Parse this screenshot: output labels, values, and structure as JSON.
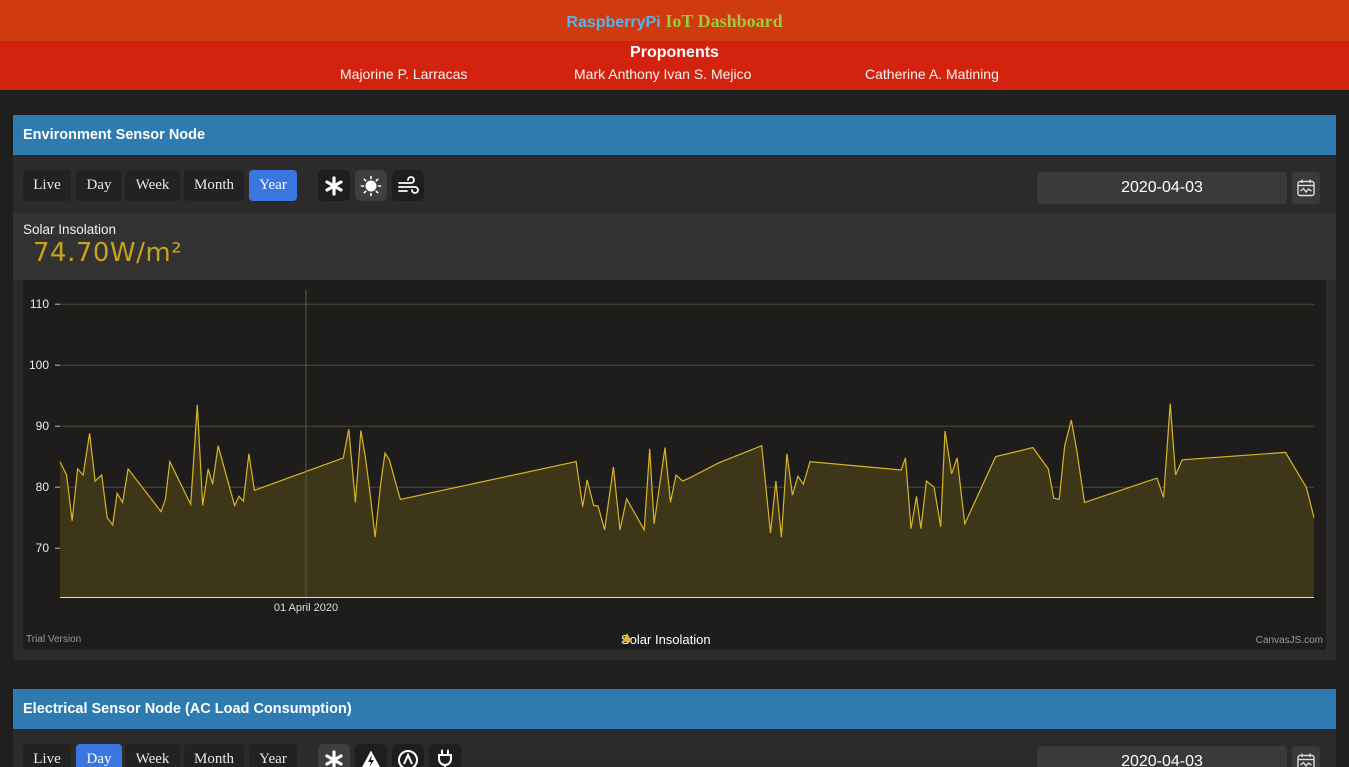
{
  "header": {
    "title_part1": "RaspberryPi",
    "title_part2": "IoT Dashboard"
  },
  "proponents": {
    "title": "Proponents",
    "names": [
      "Majorine P. Larracas",
      "Mark Anthony Ivan S. Mejico",
      "Catherine A. Matining"
    ]
  },
  "environment_panel": {
    "title": "Environment Sensor Node",
    "ranges": [
      "Live",
      "Day",
      "Week",
      "Month",
      "Year"
    ],
    "active_range": "Year",
    "sensor_icons": [
      "asterisk-icon",
      "sun-icon",
      "wind-icon"
    ],
    "active_sensor": "sun-icon",
    "date": "2020-04-03",
    "reading_label": "Solar Insolation",
    "reading_value": "74.70W/m²",
    "trial_text": "Trial Version",
    "credit_text": "CanvasJS.com",
    "colors": {
      "line": "#d8b526",
      "fill": "#403818",
      "value": "#c8a21c"
    }
  },
  "electrical_panel": {
    "title": "Electrical Sensor Node (AC Load Consumption)",
    "ranges": [
      "Live",
      "Day",
      "Week",
      "Month",
      "Year"
    ],
    "active_range": "Day",
    "sensor_icons": [
      "asterisk-icon",
      "lightning-icon",
      "gauge-icon",
      "plug-icon"
    ],
    "date": "2020-04-03"
  },
  "chart_data": {
    "type": "area",
    "title": "",
    "xlabel": "",
    "ylabel": "",
    "y_ticks": [
      70,
      80,
      90,
      100,
      110
    ],
    "ylim": [
      62,
      112
    ],
    "x_tick_labels": [
      "01 April 2020"
    ],
    "grid": true,
    "legend": "bottom-center",
    "series": [
      {
        "name": "Solar Insolation",
        "points": [
          [
            0.0,
            84.2
          ],
          [
            0.3,
            82.0
          ],
          [
            0.55,
            74.5
          ],
          [
            0.8,
            83.0
          ],
          [
            1.05,
            82.0
          ],
          [
            1.35,
            88.8
          ],
          [
            1.6,
            81.0
          ],
          [
            1.9,
            82.0
          ],
          [
            2.15,
            75.0
          ],
          [
            2.4,
            73.8
          ],
          [
            2.6,
            79.0
          ],
          [
            2.85,
            77.5
          ],
          [
            3.1,
            83.0
          ],
          [
            4.6,
            76.0
          ],
          [
            4.8,
            78.0
          ],
          [
            5.0,
            84.2
          ],
          [
            5.95,
            77.2
          ],
          [
            6.25,
            93.5
          ],
          [
            6.5,
            77.0
          ],
          [
            6.75,
            83.0
          ],
          [
            6.95,
            80.5
          ],
          [
            7.2,
            86.8
          ],
          [
            7.95,
            77.0
          ],
          [
            8.15,
            78.5
          ],
          [
            8.35,
            77.7
          ],
          [
            8.6,
            85.5
          ],
          [
            8.85,
            79.5
          ],
          [
            12.9,
            84.8
          ],
          [
            13.15,
            89.5
          ],
          [
            13.45,
            77.5
          ],
          [
            13.7,
            89.3
          ],
          [
            13.9,
            85.0
          ],
          [
            14.1,
            79.5
          ],
          [
            14.35,
            71.8
          ],
          [
            14.6,
            80.5
          ],
          [
            14.8,
            85.6
          ],
          [
            15.0,
            84.5
          ],
          [
            15.3,
            80.5
          ],
          [
            15.5,
            78.0
          ],
          [
            23.5,
            84.2
          ],
          [
            23.8,
            76.8
          ],
          [
            24.0,
            81.2
          ],
          [
            24.3,
            77.0
          ],
          [
            24.5,
            76.9
          ],
          [
            24.8,
            73.0
          ],
          [
            25.2,
            83.3
          ],
          [
            25.5,
            73.0
          ],
          [
            25.8,
            78.1
          ],
          [
            26.6,
            73.0
          ],
          [
            26.85,
            86.3
          ],
          [
            27.05,
            74.0
          ],
          [
            27.55,
            86.5
          ],
          [
            27.8,
            77.5
          ],
          [
            28.05,
            82.0
          ],
          [
            28.35,
            81.0
          ],
          [
            28.65,
            81.5
          ],
          [
            30.0,
            84.0
          ],
          [
            31.95,
            86.8
          ],
          [
            32.35,
            72.5
          ],
          [
            32.6,
            81.0
          ],
          [
            32.85,
            71.8
          ],
          [
            33.1,
            85.5
          ],
          [
            33.35,
            78.7
          ],
          [
            33.6,
            81.8
          ],
          [
            33.85,
            80.5
          ],
          [
            34.15,
            84.2
          ],
          [
            37.75,
            83.0
          ],
          [
            38.3,
            82.8
          ],
          [
            38.5,
            84.8
          ],
          [
            38.75,
            73.2
          ],
          [
            39.0,
            78.5
          ],
          [
            39.2,
            73.2
          ],
          [
            39.45,
            81.0
          ],
          [
            39.8,
            80.0
          ],
          [
            40.1,
            73.5
          ],
          [
            40.3,
            89.2
          ],
          [
            40.6,
            82.2
          ],
          [
            40.85,
            84.8
          ],
          [
            41.2,
            74.0
          ],
          [
            42.6,
            85.0
          ],
          [
            44.3,
            86.5
          ],
          [
            45.0,
            83.0
          ],
          [
            45.25,
            78.2
          ],
          [
            45.5,
            78.0
          ],
          [
            45.75,
            86.8
          ],
          [
            46.05,
            91.0
          ],
          [
            46.3,
            86.0
          ],
          [
            46.65,
            77.5
          ],
          [
            49.95,
            81.5
          ],
          [
            50.25,
            78.3
          ],
          [
            50.55,
            93.7
          ],
          [
            50.8,
            82.0
          ],
          [
            51.1,
            84.5
          ],
          [
            55.8,
            85.7
          ],
          [
            56.75,
            80.0
          ],
          [
            57.1,
            75.0
          ]
        ]
      }
    ]
  }
}
